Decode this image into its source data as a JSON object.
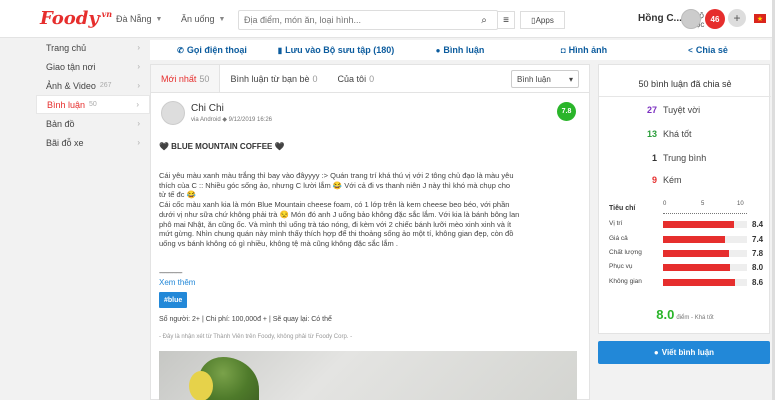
{
  "header": {
    "logo": "Foody",
    "logo_suffix": ".vn",
    "city": "Đà Nẵng",
    "category": "Ăn uống",
    "search_placeholder": "Địa điểm, món ăn, loại hình...",
    "filter_label": "Bộ lọc",
    "apps_label": "Apps",
    "user_name": "Hồng C...",
    "notif_count": "46",
    "plus_label": "+",
    "flag_label": "★"
  },
  "sidebar": {
    "items": [
      {
        "label": "Trang chủ",
        "count": ""
      },
      {
        "label": "Giao tận nơi",
        "count": ""
      },
      {
        "label": "Ảnh & Video",
        "count": "267"
      },
      {
        "label": "Bình luận",
        "count": "50"
      },
      {
        "label": "Bản đồ",
        "count": ""
      },
      {
        "label": "Bãi đỗ xe",
        "count": ""
      }
    ]
  },
  "actions": [
    {
      "label": "Gọi điện thoại",
      "icon": "phone-icon",
      "glyph": "✆"
    },
    {
      "label": "Lưu vào Bộ sưu tập (180)",
      "icon": "bookmark-icon",
      "glyph": "▮"
    },
    {
      "label": "Bình luận",
      "icon": "comment-icon",
      "glyph": "●"
    },
    {
      "label": "Hình ảnh",
      "icon": "camera-icon",
      "glyph": "◘"
    },
    {
      "label": "Chia sẻ",
      "icon": "share-icon",
      "glyph": "<"
    }
  ],
  "tabs": [
    {
      "label": "Mới nhất",
      "count": "50"
    },
    {
      "label": "Bình luận từ bạn bè",
      "count": "0"
    },
    {
      "label": "Của tôi",
      "count": "0"
    }
  ],
  "sort": {
    "selected": "Bình luận"
  },
  "review": {
    "author": "Chi Chi",
    "meta": "via Android ◆ 9/12/2019 16:26",
    "score": "7.8",
    "title": "🖤 BLUE MOUNTAIN COFFEE 🖤",
    "body": [
      "Cái yêu màu xanh màu trắng thì bay vào đâyyyy :> Quán trang trí khá thú vị với 2 tông chủ đạo là màu yêu",
      "thích của C :: Nhiều góc sống ảo, nhưng C lười lắm 😂 Với cả đi vs thanh niên J này thì khó mà chụp cho",
      "tử tế đc 😂",
      "Cái cốc màu xanh kia là món Blue Mountain cheese foam, có 1 lớp trên là kem cheese beo béo, với phần",
      "dưới vị như sữa chứ không phải trà 😒 Món đó anh J uống bảo không đặc sắc lắm. Với kia là bánh bông lan",
      "phô mai Nhật, ăn cũng ốc. Và mình thì uống trà táo nóng, đi kèm với 2 chiếc bánh lưỡi mèo xinh xinh và ít",
      "mứt gừng. Nhìn chung quán này mình thấy thích hợp để thi thoảng sống ảo một tí, không gian đẹp, còn đồ",
      "uống vs bánh không có gì nhiều, không tệ mà cũng không đặc sắc lắm ."
    ],
    "divider": "-----------------",
    "more": "Xem thêm",
    "tag": "#blue",
    "stats": "Số người: 2+ | Chi phí: 100,000đ + | Sẽ quay lại: Có thể",
    "note": "- Đây là nhận xét từ Thành Viên trên Foody, không phải từ Foody Corp. -"
  },
  "summary": {
    "title": "50 bình luận đã chia sẻ",
    "buckets": [
      {
        "count": "27",
        "label": "Tuyệt vời",
        "color": "#7b2fc0"
      },
      {
        "count": "13",
        "label": "Khá tốt",
        "color": "#2a9d3a"
      },
      {
        "count": "1",
        "label": "Trung bình",
        "color": "#333333"
      },
      {
        "count": "9",
        "label": "Kém",
        "color": "#e62e2d"
      }
    ],
    "criteria_heading": "Tiêu chí",
    "scale": [
      "0",
      "5",
      "10"
    ],
    "criteria": [
      {
        "label": "Vị trí",
        "value": 8.4
      },
      {
        "label": "Giá cả",
        "value": 7.4
      },
      {
        "label": "Chất lượng",
        "value": 7.8
      },
      {
        "label": "Phục vụ",
        "value": 8.0
      },
      {
        "label": "Không gian",
        "value": 8.6
      }
    ],
    "criteria_display": [
      "8.4",
      "7.4",
      "7.8",
      "8.0",
      "8.6"
    ],
    "overall": "8.0",
    "overall_label": "điểm - Khá tốt"
  },
  "write_button": "Viết bình luận"
}
